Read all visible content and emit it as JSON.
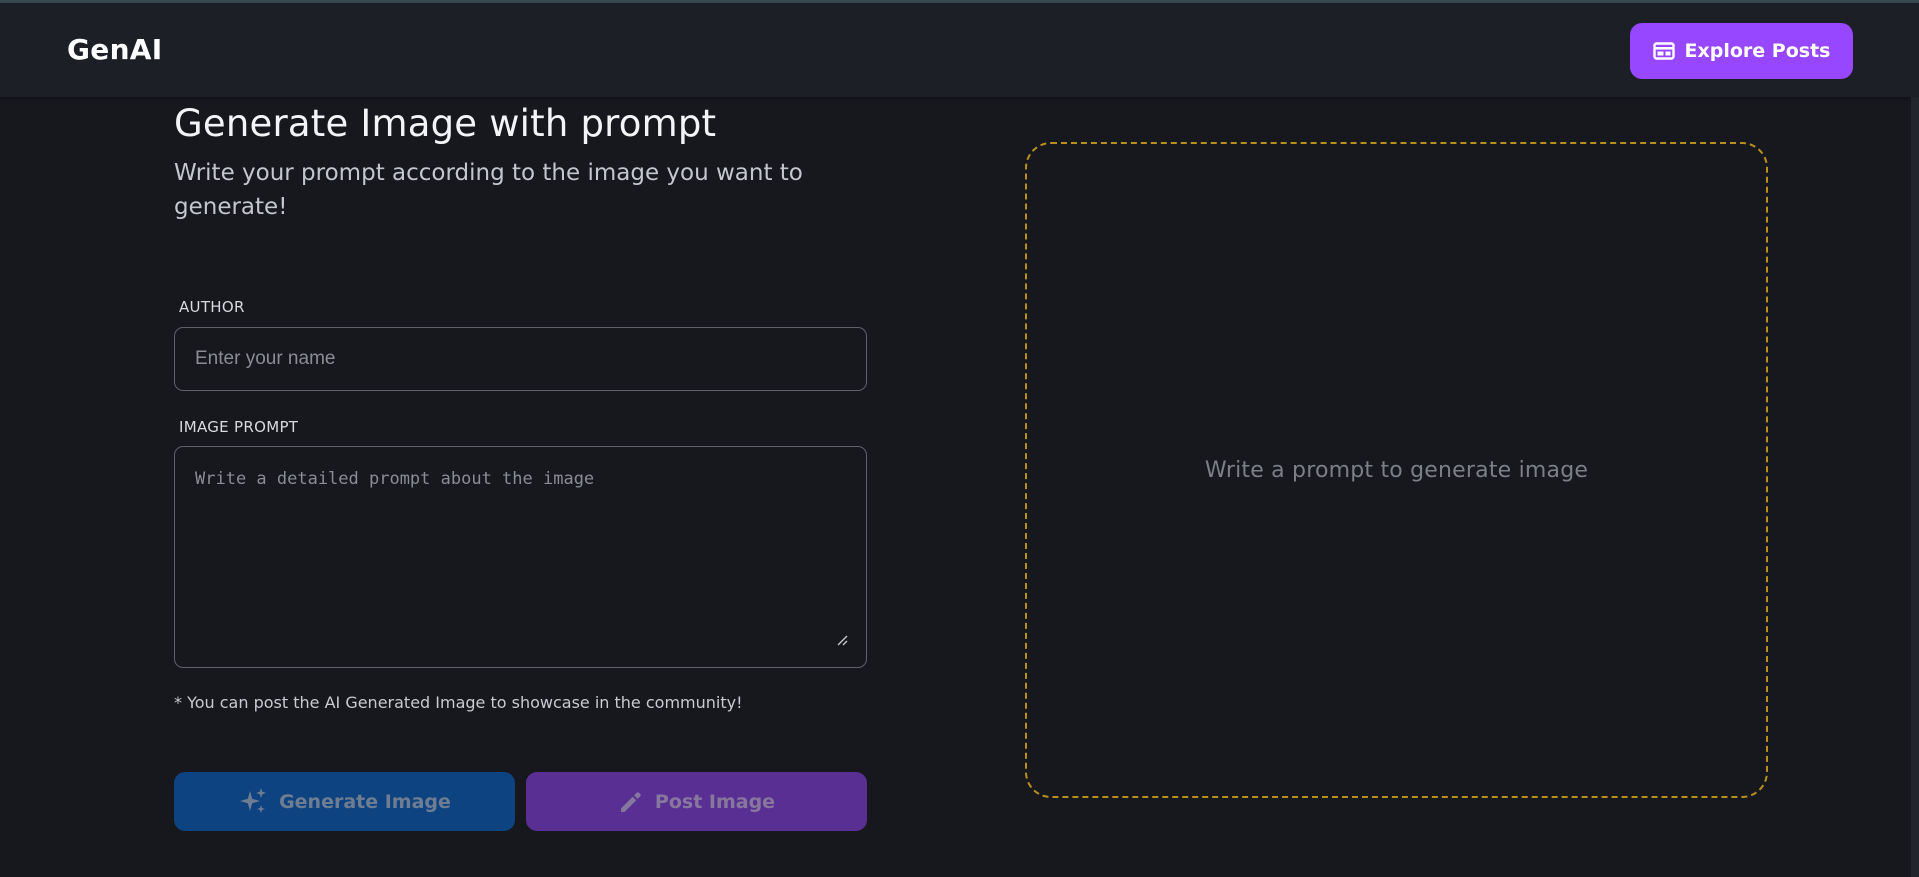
{
  "app": {
    "logo": "GenAI"
  },
  "navbar": {
    "explore_label": "Explore Posts",
    "explore_icon": "web-icon"
  },
  "form": {
    "title": "Generate Image with prompt",
    "subtitle": "Write your prompt according to the image you want to generate!",
    "author": {
      "label": "AUTHOR",
      "placeholder": "Enter your name",
      "value": ""
    },
    "prompt": {
      "label": "IMAGE PROMPT",
      "placeholder": "Write a detailed prompt about the image",
      "value": ""
    },
    "note": "* You can post the AI Generated Image to showcase in the community!",
    "generate_label": "Generate Image",
    "generate_icon": "sparkles-icon",
    "post_label": "Post Image",
    "post_icon": "pencil-icon"
  },
  "preview": {
    "placeholder": "Write a prompt to generate image",
    "border_color": "#b9901b"
  },
  "colors": {
    "accent": "#9747ff",
    "generate": "#0d4381",
    "post": "#5a2f94",
    "background": "#16181e",
    "navbar": "#1d1f27"
  }
}
